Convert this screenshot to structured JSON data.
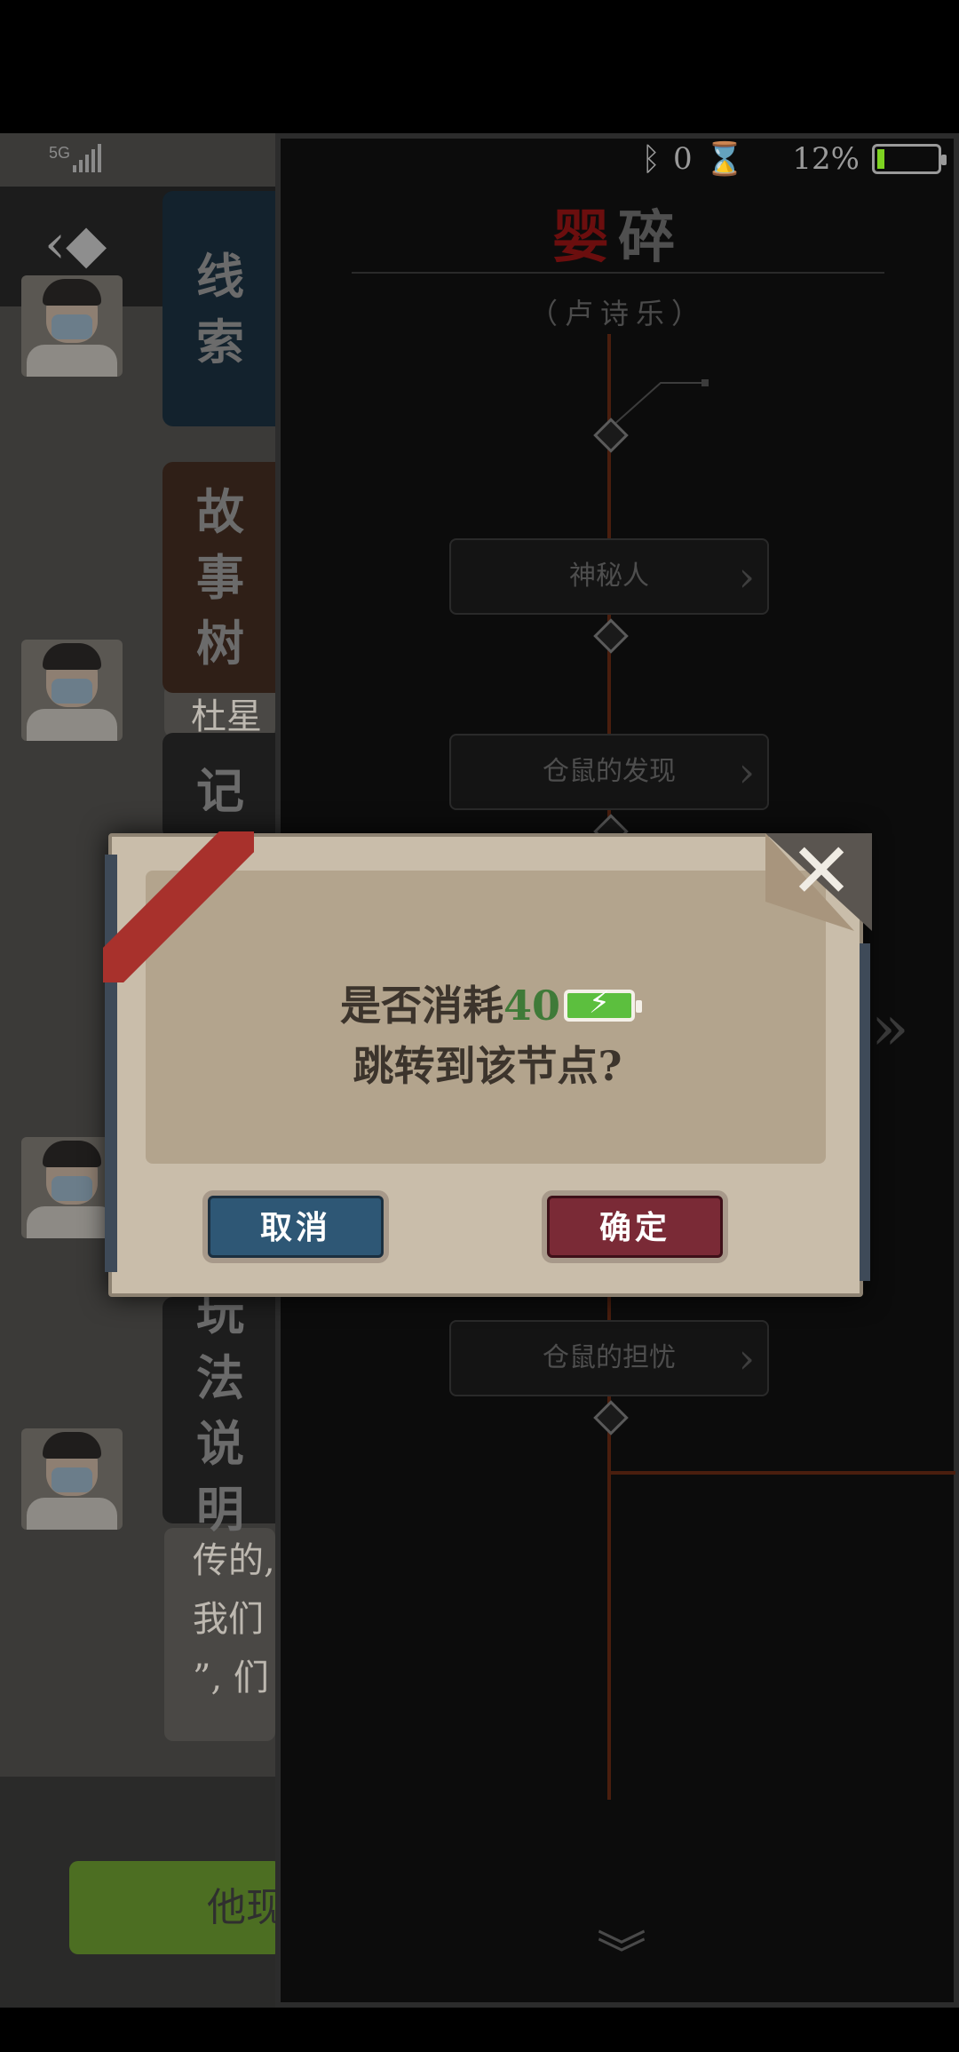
{
  "status_bar": {
    "network": "5G",
    "right_counter": "0",
    "battery_percent": "12%",
    "battery_level": 0.12
  },
  "background": {
    "side_tabs": [
      {
        "label": "线\n索"
      },
      {
        "label": "故\n事\n树"
      },
      {
        "label": "记"
      },
      {
        "label": "玩\n法\n说\n明"
      }
    ],
    "bubble_snippets": [
      "杜星",
      "传的,",
      "我们",
      "”, 们"
    ],
    "bottom_button": "他现"
  },
  "story_tree": {
    "title_red": "婴",
    "title_rest": "碎",
    "subtitle": "（卢诗乐）",
    "nodes": [
      "神秘人",
      "仓鼠的发现",
      "仓鼠的担忧"
    ]
  },
  "dialog": {
    "line1_prefix": "是否消耗",
    "cost": "40",
    "line2": "跳转到该节点?",
    "cancel_label": "取消",
    "confirm_label": "确定",
    "close_icon": "close-icon"
  },
  "colors": {
    "dialog_bg": "#c9bdaa",
    "cancel": "#2e5775",
    "confirm": "#7a2a36",
    "energy": "#5cbf3e",
    "title_red": "#6b0e0e"
  }
}
